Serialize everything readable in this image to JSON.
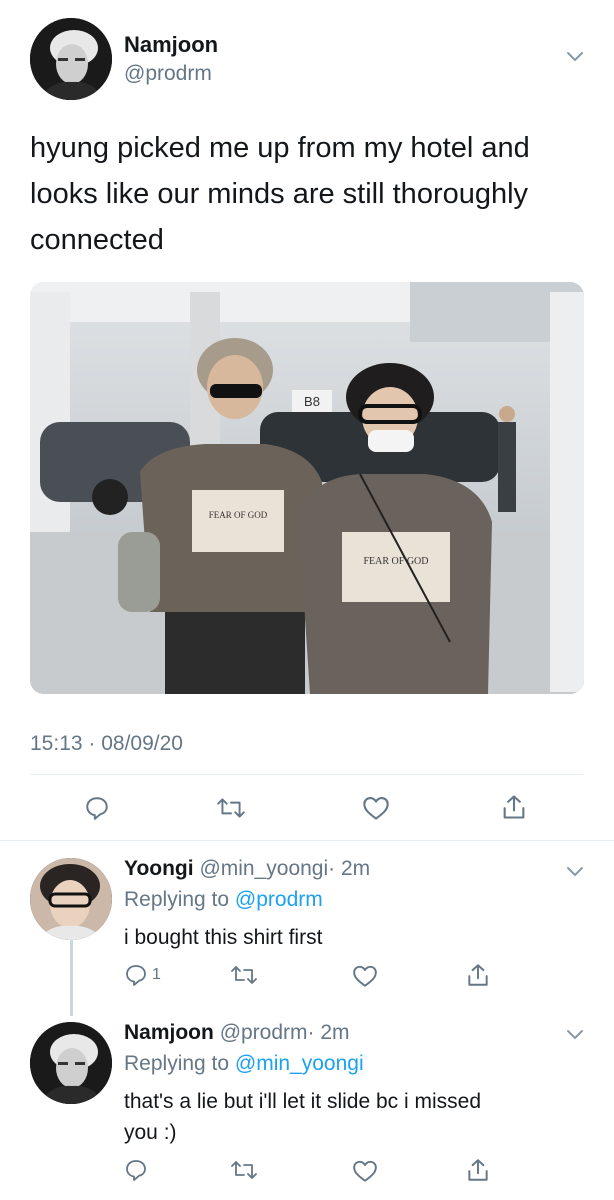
{
  "main_tweet": {
    "name": "Namjoon",
    "handle": "@prodrm",
    "text": "hyung picked me up from my hotel and looks like our minds are still thoroughly connected",
    "timestamp": "15:13 · 08/09/20",
    "photo": {
      "shirt_left_text": "FEAR OF GOD",
      "shirt_right_text": "FEAR OF GOD",
      "sign_text": "B8"
    },
    "icons": [
      "reply-icon",
      "retweet-icon",
      "like-icon",
      "share-icon"
    ]
  },
  "replies": [
    {
      "name": "Yoongi",
      "handle": "@min_yoongi",
      "time": "· 2m",
      "replying_prefix": "Replying to ",
      "replying_to": "@prodrm",
      "text": "i bought this shirt first",
      "reply_count": "1"
    },
    {
      "name": "Namjoon",
      "handle": "@prodrm",
      "time": "· 2m",
      "replying_prefix": "Replying to ",
      "replying_to": "@min_yoongi",
      "text_line1": "that's a lie but i'll let it slide bc i missed",
      "text_line2": "you :)"
    }
  ],
  "colors": {
    "accent": "#1da1f2",
    "muted": "#657786",
    "divider": "#e6ecf0"
  }
}
